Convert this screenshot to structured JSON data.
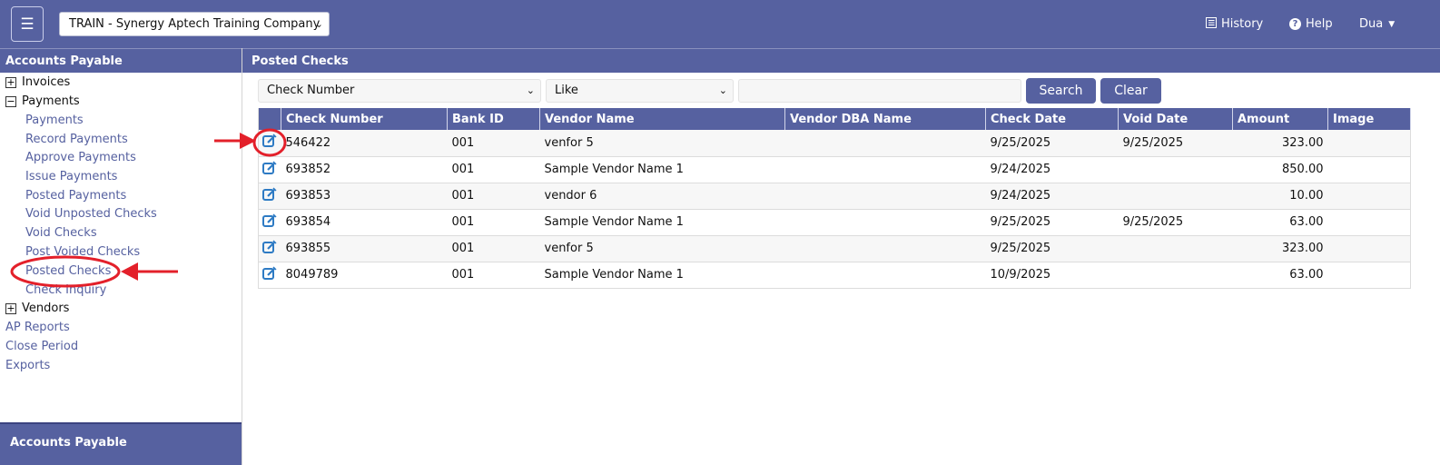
{
  "topbar": {
    "menu_icon": "hamburger-menu-icon",
    "company_select": "TRAIN - Synergy Aptech Training Company",
    "history_label": "History",
    "help_label": "Help",
    "user_label": "Dua"
  },
  "sidebar": {
    "title": "Accounts Payable",
    "footer_title": "Accounts Payable",
    "invoices": {
      "label": "Invoices",
      "toggle": "+"
    },
    "payments": {
      "label": "Payments",
      "toggle": "−"
    },
    "payment_items": [
      "Payments",
      "Record Payments",
      "Approve Payments",
      "Issue Payments",
      "Posted Payments",
      "Void Unposted Checks",
      "Void Checks",
      "Post Voided Checks",
      "Posted Checks",
      "Check Inquiry"
    ],
    "vendors": {
      "label": "Vendors",
      "toggle": "+"
    },
    "links": [
      "AP Reports",
      "Close Period",
      "Exports"
    ]
  },
  "main": {
    "title": "Posted Checks",
    "filter": {
      "field_value": "Check Number",
      "operator_value": "Like",
      "search_value": "",
      "search_button": "Search",
      "clear_button": "Clear"
    },
    "columns": [
      "",
      "Check Number",
      "Bank ID",
      "Vendor Name",
      "Vendor DBA Name",
      "Check Date",
      "Void Date",
      "Amount",
      "Image"
    ],
    "rows": [
      {
        "check_number": "546422",
        "bank_id": "001",
        "vendor_name": "venfor 5",
        "vendor_dba": "",
        "check_date": "9/25/2025",
        "void_date": "9/25/2025",
        "amount": "323.00",
        "image": ""
      },
      {
        "check_number": "693852",
        "bank_id": "001",
        "vendor_name": "Sample Vendor Name 1",
        "vendor_dba": "",
        "check_date": "9/24/2025",
        "void_date": "",
        "amount": "850.00",
        "image": ""
      },
      {
        "check_number": "693853",
        "bank_id": "001",
        "vendor_name": "vendor 6",
        "vendor_dba": "",
        "check_date": "9/24/2025",
        "void_date": "",
        "amount": "10.00",
        "image": ""
      },
      {
        "check_number": "693854",
        "bank_id": "001",
        "vendor_name": "Sample Vendor Name 1",
        "vendor_dba": "",
        "check_date": "9/25/2025",
        "void_date": "9/25/2025",
        "amount": "63.00",
        "image": ""
      },
      {
        "check_number": "693855",
        "bank_id": "001",
        "vendor_name": "venfor 5",
        "vendor_dba": "",
        "check_date": "9/25/2025",
        "void_date": "",
        "amount": "323.00",
        "image": ""
      },
      {
        "check_number": "8049789",
        "bank_id": "001",
        "vendor_name": "Sample Vendor Name 1",
        "vendor_dba": "",
        "check_date": "10/9/2025",
        "void_date": "",
        "amount": "63.00",
        "image": ""
      }
    ]
  },
  "colors": {
    "brand": "#5661a0",
    "link": "#5661a0",
    "annotation": "#e3202a",
    "edit_icon": "#2e7bc4"
  }
}
